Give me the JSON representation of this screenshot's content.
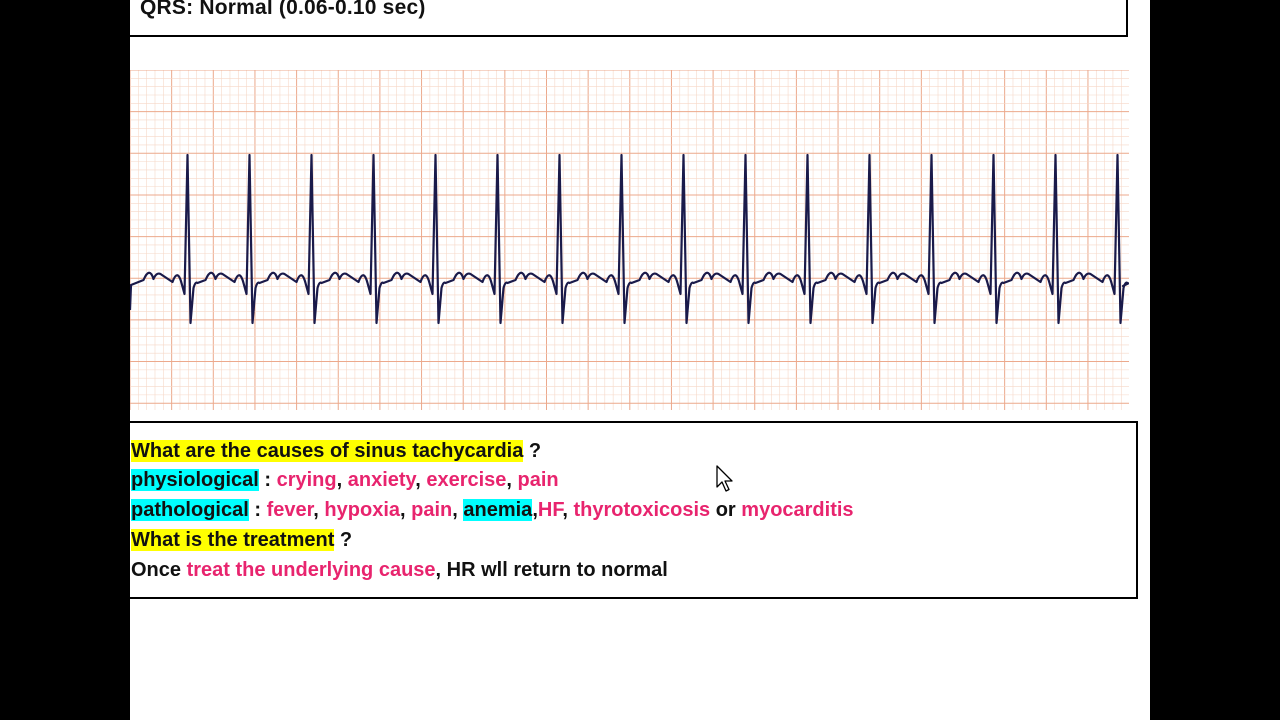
{
  "header": {
    "title": "QRS: Normal (0.06-0.10 sec)"
  },
  "colors": {
    "grid_minor": "#f6d8c8",
    "grid_major": "#eca98c",
    "trace": "#1a1a4a",
    "highlight_yellow": "#ffff00",
    "highlight_cyan": "#00ffff",
    "pink_text": "#e8246e"
  },
  "ecg": {
    "rhythm": "sinus tachycardia",
    "beat_count": 16
  },
  "content": {
    "q1": "What are the causes of sinus tachycardia",
    "q1_mark": " ?",
    "physio_label": "physiological",
    "physio_sep": " : ",
    "physio_items": [
      "crying",
      "anxiety",
      "exercise",
      "pain"
    ],
    "patho_label": "pathological",
    "patho_sep": " : ",
    "patho_items": [
      "fever",
      "hypoxia",
      "pain"
    ],
    "patho_anemia": "anemia",
    "patho_hf": "HF",
    "patho_thyro": "thyrotoxicosis",
    "patho_or": " or ",
    "patho_myo": "myocarditis",
    "q2": "What is the treatment",
    "q2_mark": " ?",
    "ans_prefix": "Once ",
    "ans_pink": "treat the underlying cause",
    "ans_suffix": ", HR wll return to normal"
  }
}
